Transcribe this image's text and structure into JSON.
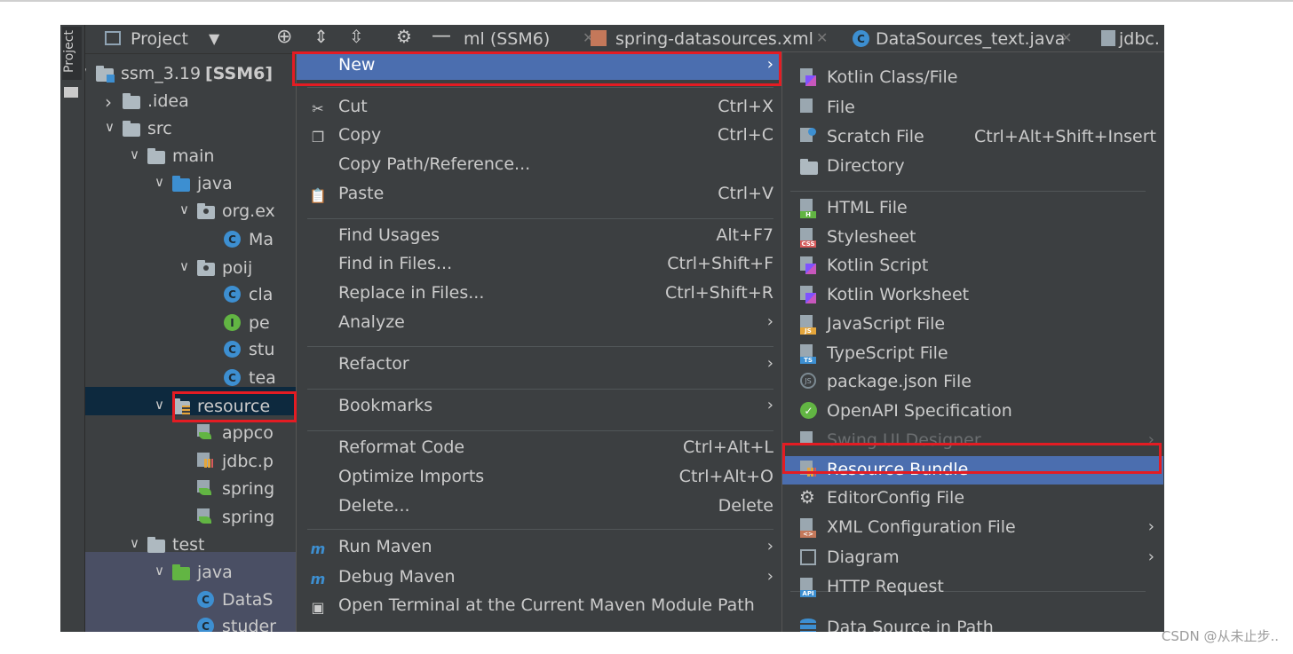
{
  "tool_window": {
    "side_label": "Project"
  },
  "toolbar": {
    "project_label": "Project",
    "tabs": [
      {
        "label": "ml (SSM6)"
      },
      {
        "label": "spring-datasources.xml"
      },
      {
        "label": "DataSources_text.java"
      },
      {
        "label": "jdbc."
      }
    ]
  },
  "tree": {
    "items": [
      {
        "label": "ssm_3.19",
        "module": "[SSM6]"
      },
      {
        "label": ".idea"
      },
      {
        "label": "src"
      },
      {
        "label": "main"
      },
      {
        "label": "java"
      },
      {
        "label": "org.ex"
      },
      {
        "label": "Ma"
      },
      {
        "label": "poij"
      },
      {
        "label": "cla"
      },
      {
        "label": "pe"
      },
      {
        "label": "stu"
      },
      {
        "label": "tea"
      },
      {
        "label": "resource"
      },
      {
        "label": "appco"
      },
      {
        "label": "jdbc.p"
      },
      {
        "label": "spring"
      },
      {
        "label": "spring"
      },
      {
        "label": "test"
      },
      {
        "label": "java"
      },
      {
        "label": "DataS"
      },
      {
        "label": "studer"
      }
    ]
  },
  "context_menu": {
    "items": [
      {
        "label": "New",
        "shortcut": "",
        "icon": ""
      },
      {
        "label": "Cut",
        "shortcut": "Ctrl+X",
        "icon": "scissors-icon"
      },
      {
        "label": "Copy",
        "shortcut": "Ctrl+C",
        "icon": "copy-icon"
      },
      {
        "label": "Copy Path/Reference...",
        "shortcut": "",
        "icon": ""
      },
      {
        "label": "Paste",
        "shortcut": "Ctrl+V",
        "icon": "paste-icon"
      },
      {
        "label": "Find Usages",
        "shortcut": "Alt+F7",
        "icon": ""
      },
      {
        "label": "Find in Files...",
        "shortcut": "Ctrl+Shift+F",
        "icon": ""
      },
      {
        "label": "Replace in Files...",
        "shortcut": "Ctrl+Shift+R",
        "icon": ""
      },
      {
        "label": "Analyze",
        "shortcut": "",
        "icon": ""
      },
      {
        "label": "Refactor",
        "shortcut": "",
        "icon": ""
      },
      {
        "label": "Bookmarks",
        "shortcut": "",
        "icon": ""
      },
      {
        "label": "Reformat Code",
        "shortcut": "Ctrl+Alt+L",
        "icon": ""
      },
      {
        "label": "Optimize Imports",
        "shortcut": "Ctrl+Alt+O",
        "icon": ""
      },
      {
        "label": "Delete...",
        "shortcut": "Delete",
        "icon": ""
      },
      {
        "label": "Run Maven",
        "shortcut": "",
        "icon": "maven-run-icon"
      },
      {
        "label": "Debug Maven",
        "shortcut": "",
        "icon": "maven-debug-icon"
      },
      {
        "label": "Open Terminal at the Current Maven Module Path",
        "shortcut": "",
        "icon": "terminal-maven-icon"
      }
    ]
  },
  "new_submenu": {
    "items": [
      {
        "label": "Kotlin Class/File",
        "shortcut": ""
      },
      {
        "label": "File",
        "shortcut": ""
      },
      {
        "label": "Scratch File",
        "shortcut": "Ctrl+Alt+Shift+Insert"
      },
      {
        "label": "Directory",
        "shortcut": ""
      },
      {
        "label": "HTML File",
        "shortcut": ""
      },
      {
        "label": "Stylesheet",
        "shortcut": ""
      },
      {
        "label": "Kotlin Script",
        "shortcut": ""
      },
      {
        "label": "Kotlin Worksheet",
        "shortcut": ""
      },
      {
        "label": "JavaScript File",
        "shortcut": ""
      },
      {
        "label": "TypeScript File",
        "shortcut": ""
      },
      {
        "label": "package.json File",
        "shortcut": ""
      },
      {
        "label": "OpenAPI Specification",
        "shortcut": ""
      },
      {
        "label": "Swing UI Designer",
        "shortcut": ""
      },
      {
        "label": "Resource Bundle",
        "shortcut": ""
      },
      {
        "label": "EditorConfig File",
        "shortcut": ""
      },
      {
        "label": "XML Configuration File",
        "shortcut": ""
      },
      {
        "label": "Diagram",
        "shortcut": ""
      },
      {
        "label": "HTTP Request",
        "shortcut": ""
      },
      {
        "label": "Data Source in Path",
        "shortcut": ""
      }
    ],
    "icon_tags": {
      "html": "H",
      "css": "CSS",
      "js": "JS",
      "ts": "TS",
      "api": "API"
    }
  },
  "watermark": "CSDN @从未止步.."
}
